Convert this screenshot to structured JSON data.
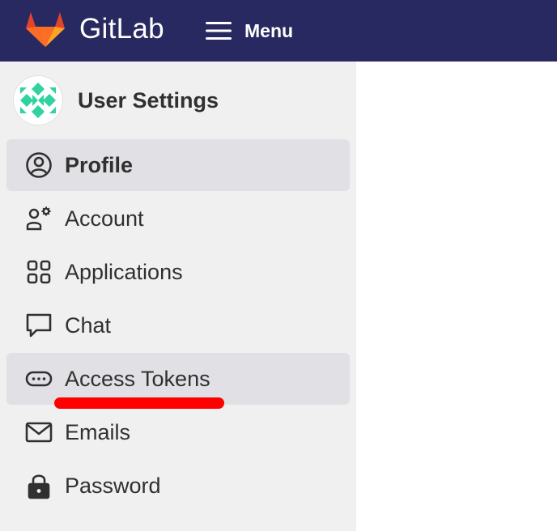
{
  "header": {
    "brand": "GitLab",
    "menu_label": "Menu",
    "colors": {
      "bar": "#292961",
      "logo_orange": "#fc6d26",
      "logo_red": "#e24329",
      "logo_light": "#fca326"
    }
  },
  "sidebar": {
    "context_title": "User Settings",
    "items": [
      {
        "label": "Profile",
        "icon": "profile-icon",
        "active": true
      },
      {
        "label": "Account",
        "icon": "account-icon"
      },
      {
        "label": "Applications",
        "icon": "applications-icon"
      },
      {
        "label": "Chat",
        "icon": "chat-icon"
      },
      {
        "label": "Access Tokens",
        "icon": "token-icon",
        "active": true
      },
      {
        "label": "Emails",
        "icon": "mail-icon"
      },
      {
        "label": "Password",
        "icon": "lock-icon"
      }
    ],
    "colors": {
      "background": "#f0f0f0",
      "active": "#e1e1e5",
      "avatar_accent": "#2fd2a0"
    }
  },
  "annotation": {
    "color": "#ff0000"
  }
}
